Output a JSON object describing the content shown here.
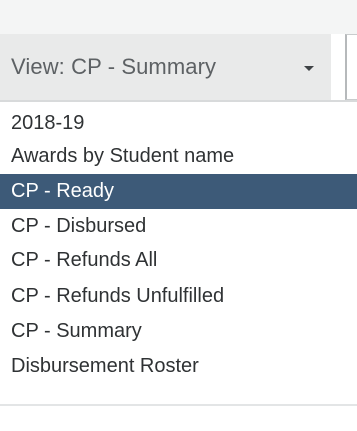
{
  "view_select": {
    "label": "View: CP - Summary",
    "icon": "caret-down"
  },
  "menu": {
    "items": [
      {
        "label": "2018-19",
        "selected": false
      },
      {
        "label": "Awards by Student name",
        "selected": false
      },
      {
        "label": "CP - Ready",
        "selected": true
      },
      {
        "label": "CP - Disbursed",
        "selected": false
      },
      {
        "label": "CP - Refunds All",
        "selected": false
      },
      {
        "label": "CP - Refunds Unfulfilled",
        "selected": false
      },
      {
        "label": "CP - Summary",
        "selected": false
      },
      {
        "label": "Disbursement Roster",
        "selected": false
      }
    ]
  },
  "colors": {
    "selected_background": "#3d5a78",
    "selected_text": "#ffffff",
    "item_text": "#2f3234",
    "select_background": "#e9eaea"
  }
}
